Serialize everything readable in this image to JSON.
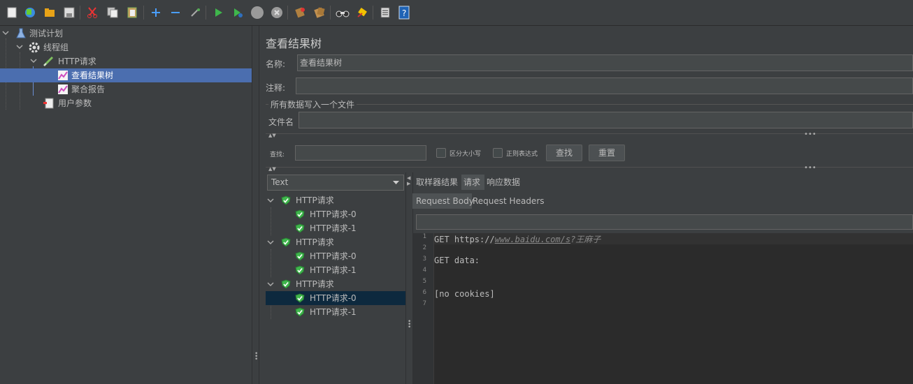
{
  "colors": {
    "background": "#3c3f41",
    "selection": "#4b6eaf",
    "editor_bg": "#2b2b2b",
    "check_green": "#3fb64c"
  },
  "toolbar": {
    "icons": [
      "new-icon",
      "templates-icon",
      "open-icon",
      "save-icon",
      "cut-icon",
      "copy-icon",
      "paste-icon",
      "expand-icon",
      "collapse-icon",
      "toggle-icon",
      "start-icon",
      "start-no-pause-icon",
      "stop-icon",
      "shutdown-icon",
      "clear-icon",
      "clear-all-icon",
      "search-icon",
      "reset-search-icon",
      "function-helper-icon",
      "help-icon"
    ]
  },
  "tree": {
    "items": [
      {
        "label": "测试计划",
        "icon": "test-plan-icon"
      },
      {
        "label": "线程组",
        "icon": "thread-group-icon"
      },
      {
        "label": "HTTP请求",
        "icon": "http-sampler-icon"
      },
      {
        "label": "查看结果树",
        "icon": "listener-icon"
      },
      {
        "label": "聚合报告",
        "icon": "listener-icon"
      },
      {
        "label": "用户参数",
        "icon": "preprocessor-icon"
      }
    ]
  },
  "panel": {
    "title": "查看结果树",
    "name_label": "名称:",
    "name_value": "查看结果树",
    "comment_label": "注释:",
    "comment_value": "",
    "file_section_label": "所有数据写入一个文件",
    "filename_label": "文件名",
    "filename_value": ""
  },
  "search": {
    "label": "查找:",
    "value": "",
    "case_sensitive_label": "区分大小写",
    "regex_label": "正则表达式",
    "find_button": "查找",
    "reset_button": "重置"
  },
  "results": {
    "renderer_selected": "Text",
    "items": [
      {
        "label": "HTTP请求",
        "level": 0
      },
      {
        "label": "HTTP请求-0",
        "level": 1
      },
      {
        "label": "HTTP请求-1",
        "level": 1
      },
      {
        "label": "HTTP请求",
        "level": 0
      },
      {
        "label": "HTTP请求-0",
        "level": 1
      },
      {
        "label": "HTTP请求-1",
        "level": 1
      },
      {
        "label": "HTTP请求",
        "level": 0
      },
      {
        "label": "HTTP请求-0",
        "level": 1
      },
      {
        "label": "HTTP请求-1",
        "level": 1
      }
    ]
  },
  "tabs": {
    "main": [
      "取样器结果",
      "请求",
      "响应数据"
    ],
    "main_active": "请求",
    "sub": [
      "Request Body",
      "Request Headers"
    ],
    "sub_active": "Request Body"
  },
  "editor": {
    "line_numbers": [
      "1",
      "2",
      "3",
      "4",
      "5",
      "6",
      "7"
    ],
    "line1_prefix": "GET https://",
    "line1_url": "www.baidu.com/s",
    "line1_suffix": "?王麻子",
    "line3": "GET data:",
    "line6": "[no cookies]"
  }
}
